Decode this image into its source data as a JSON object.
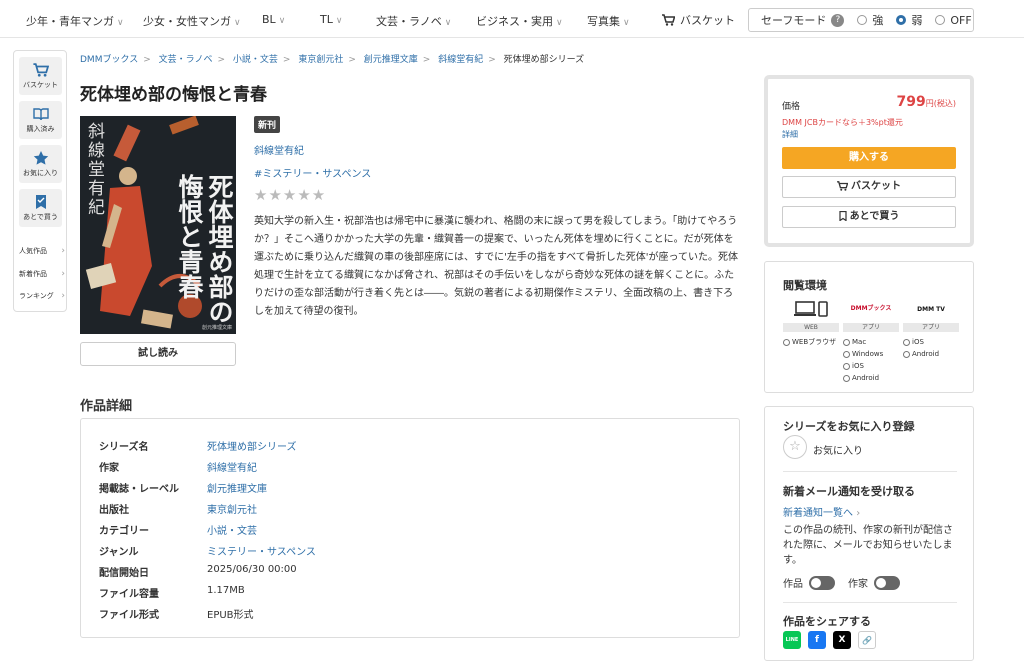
{
  "nav": {
    "categories": [
      {
        "label": "少年・青年マンガ"
      },
      {
        "label": "少女・女性マンガ"
      },
      {
        "label": "BL"
      },
      {
        "label": "TL"
      },
      {
        "label": "文芸・ラノベ"
      },
      {
        "label": "ビジネス・実用"
      },
      {
        "label": "写真集"
      }
    ],
    "basket": "バスケット",
    "safe_mode": {
      "label": "セーフモード",
      "help": "?",
      "options": [
        "強",
        "弱",
        "OFF"
      ],
      "selected": "弱"
    }
  },
  "sidebar": {
    "buttons": [
      {
        "label": "バスケット",
        "icon": "cart-icon"
      },
      {
        "label": "購入済み",
        "icon": "book-icon"
      },
      {
        "label": "お気に入り",
        "icon": "star-icon"
      },
      {
        "label": "あとで買う",
        "icon": "bookmark-check-icon"
      }
    ],
    "links": [
      "人気作品",
      "新着作品",
      "ランキング"
    ]
  },
  "breadcrumb": [
    "DMMブックス",
    "文芸・ラノベ",
    "小説・文芸",
    "東京創元社",
    "創元推理文庫",
    "斜線堂有紀",
    "死体埋め部シリーズ"
  ],
  "product": {
    "title": "死体埋め部の悔恨と青春",
    "badge": "新刊",
    "author": "斜線堂有紀",
    "genre_tag": "#ミステリー・サスペンス",
    "rating_stars": "★★★★★",
    "description": "英知大学の新入生・祝部浩也は帰宅中に暴漢に襲われ、格闘の末に誤って男を殺してしまう。「助けてやろうか？」そこへ通りかかった大学の先輩・織賀善一の提案で、いったん死体を埋めに行くことに。だが死体を運ぶために乗り込んだ織賀の車の後部座席には、すでに'左手の指をすべて骨折した死体'が座っていた。死体処理で生計を立てる織賀になかば脅され、祝部はその手伝いをしながら奇妙な死体の謎を解くことに。ふたりだけの歪な部活動が行き着く先とは――。気鋭の著者による初期傑作ミステリ、全面改稿の上、書き下ろしを加えて待望の復刊。",
    "cover": {
      "author": "斜線堂有紀",
      "title": "死体埋め部の悔恨と青春",
      "pub_mark": "創元推理文庫"
    },
    "trial": "試し読み"
  },
  "details": {
    "heading": "作品詳細",
    "rows": [
      {
        "key": "シリーズ名",
        "value": "死体埋め部シリーズ",
        "link": true
      },
      {
        "key": "作家",
        "value": "斜線堂有紀",
        "link": true
      },
      {
        "key": "掲載誌・レーベル",
        "value": "創元推理文庫",
        "link": true
      },
      {
        "key": "出版社",
        "value": "東京創元社",
        "link": true
      },
      {
        "key": "カテゴリー",
        "value": "小説・文芸",
        "link": true
      },
      {
        "key": "ジャンル",
        "value": "ミステリー・サスペンス",
        "link": true
      },
      {
        "key": "配信開始日",
        "value": "2025/06/30 00:00",
        "link": false
      },
      {
        "key": "ファイル容量",
        "value": "1.17MB",
        "link": false
      },
      {
        "key": "ファイル形式",
        "value": "EPUB形式",
        "link": false
      }
    ]
  },
  "purchase": {
    "price_label": "価格",
    "price": "799",
    "price_unit": "円(税込)",
    "campaign": "DMM JCBカードなら＋3%pt還元",
    "more": "詳細",
    "buy": "購入する",
    "basket": "バスケット",
    "later": "あとで買う"
  },
  "environment": {
    "heading": "閲覧環境",
    "columns": [
      {
        "logo": "pc-phone-icon",
        "tag": "WEB",
        "items": [
          "WEBブラウザ"
        ]
      },
      {
        "logo": "DMMブックス",
        "tag": "アプリ",
        "items": [
          "Mac",
          "Windows",
          "iOS",
          "Android"
        ]
      },
      {
        "logo": "DMM TV",
        "tag": "アプリ",
        "items": [
          "iOS",
          "Android"
        ]
      }
    ]
  },
  "series": {
    "heading": "シリーズをお気に入り登録",
    "fav_label": "お気に入り",
    "notify_heading": "新着メール通知を受け取る",
    "notify_link": "新着通知一覧へ",
    "notify_text": "この作品の続刊、作家の新刊が配信された際に、メールでお知らせいたします。",
    "toggle_work": "作品",
    "toggle_author": "作家",
    "share_heading": "作品をシェアする",
    "share": [
      {
        "name": "line",
        "label": "LINE",
        "color": "#06c755"
      },
      {
        "name": "facebook",
        "label": "f",
        "color": "#1877f2"
      },
      {
        "name": "x",
        "label": "X",
        "color": "#000000"
      },
      {
        "name": "link",
        "label": "🔗",
        "color": "#ffffff"
      }
    ]
  }
}
